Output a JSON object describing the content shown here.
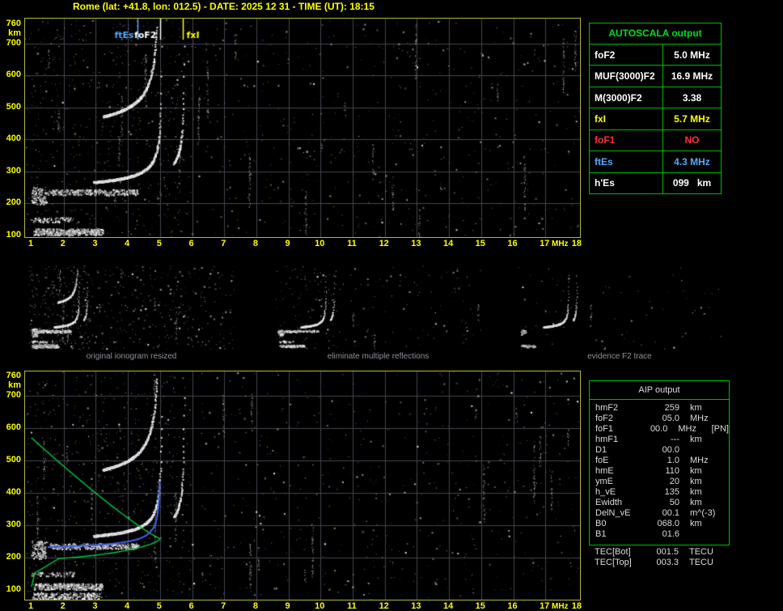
{
  "title": "Rome (lat: +41.8, lon: 012.5) - DATE: 2025 12 31 - TIME (UT): 18:15",
  "colors": {
    "axis_yellow": "#ffff00",
    "panel_green": "#00bb00",
    "marker_blue": "#55aaff",
    "alert_red": "#ff3333",
    "profile_green": "#00cc44",
    "fitted_trace_blue": "#4060ee",
    "plot_border": "#b5b53e"
  },
  "ionogram": {
    "x_unit": "MHz",
    "y_unit": "km",
    "x_ticks": [
      "1",
      "2",
      "3",
      "4",
      "5",
      "6",
      "7",
      "8",
      "9",
      "10",
      "11",
      "12",
      "13",
      "14",
      "15",
      "16",
      "17",
      "18"
    ],
    "y_ticks": [
      "760",
      "700",
      "600",
      "500",
      "400",
      "300",
      "200",
      "100"
    ],
    "y_tick_values": [
      760,
      700,
      600,
      500,
      400,
      300,
      200,
      100
    ],
    "markers": [
      {
        "label": "ftEs",
        "f": 4.3,
        "color": "#55aaff",
        "label_side": "left"
      },
      {
        "label": "foF2",
        "f": 5.0,
        "color": "#ffffff",
        "label_side": "left"
      },
      {
        "label": "fxI",
        "f": 5.7,
        "color": "#ffff00",
        "label_side": "right"
      }
    ],
    "scaled": {
      "foF2_MHz": 5.0,
      "fxI_MHz": 5.7,
      "ftEs_MHz": 4.3,
      "hmF2_km": 259
    }
  },
  "autoscala_table": {
    "title": "AUTOSCALA output",
    "rows": [
      {
        "label": "foF2",
        "value": "5.0 MHz",
        "color": "#ffffff"
      },
      {
        "label": "MUF(3000)F2",
        "value": "16.9 MHz",
        "color": "#ffffff"
      },
      {
        "label": "M(3000)F2",
        "value": "3.38",
        "color": "#ffffff"
      },
      {
        "label": "fxI",
        "value": "5.7 MHz",
        "color": "#ffff00"
      },
      {
        "label": "foF1",
        "value": "NO",
        "color": "#ff3333"
      },
      {
        "label": "ftEs",
        "value": "4.3 MHz",
        "color": "#55aaff"
      },
      {
        "label": "h'Es",
        "value": "099   km",
        "color": "#ffffff"
      }
    ]
  },
  "thumbnails": [
    {
      "caption": "original ionogram resized"
    },
    {
      "caption": "eliminate multiple reflections"
    },
    {
      "caption": "evidence F2 trace"
    }
  ],
  "aip_table": {
    "title": "AIP output",
    "rows": [
      {
        "label": "hmF2",
        "value": "259",
        "unit": "km",
        "note": ""
      },
      {
        "label": "foF2",
        "value": "05.0",
        "unit": "MHz",
        "note": ""
      },
      {
        "label": "foF1",
        "value": "00.0",
        "unit": "MHz",
        "note": "[PN]"
      },
      {
        "label": "hmF1",
        "value": "---",
        "unit": "km",
        "note": ""
      },
      {
        "label": "D1",
        "value": "00.0",
        "unit": "",
        "note": ""
      },
      {
        "label": "foE",
        "value": "1.0",
        "unit": "MHz",
        "note": ""
      },
      {
        "label": "hmE",
        "value": "110",
        "unit": "km",
        "note": ""
      },
      {
        "label": "ymE",
        "value": "20",
        "unit": "km",
        "note": ""
      },
      {
        "label": "h_vE",
        "value": "135",
        "unit": "km",
        "note": ""
      },
      {
        "label": "Ewidth",
        "value": "50",
        "unit": "km",
        "note": ""
      },
      {
        "label": "DelN_vE",
        "value": "00.1",
        "unit": "m^(-3)",
        "note": ""
      },
      {
        "label": "B0",
        "value": "068.0",
        "unit": "km",
        "note": ""
      },
      {
        "label": "B1",
        "value": "01.6",
        "unit": "",
        "note": ""
      }
    ],
    "tec_rows": [
      {
        "label": "TEC[Bot]",
        "value": "001.5",
        "unit": "TECU"
      },
      {
        "label": "TEC[Top]",
        "value": "003.3",
        "unit": "TECU"
      }
    ]
  }
}
